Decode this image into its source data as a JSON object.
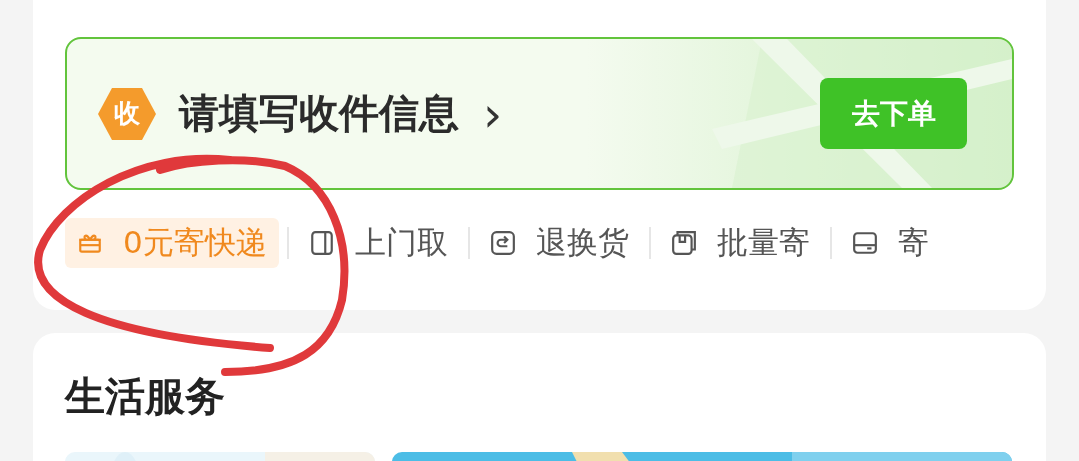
{
  "banner": {
    "badge": "收",
    "title": "请填写收件信息",
    "chevron": "›",
    "button": "去下单"
  },
  "quick_actions": [
    {
      "kind": "gift",
      "label": "0元寄快递",
      "selected": true
    },
    {
      "kind": "door",
      "label": "上门取",
      "selected": false
    },
    {
      "kind": "return",
      "label": "退换货",
      "selected": false
    },
    {
      "kind": "batch",
      "label": "批量寄",
      "selected": false
    },
    {
      "kind": "card",
      "label": "寄",
      "selected": false
    }
  ],
  "section": {
    "title": "生活服务"
  }
}
